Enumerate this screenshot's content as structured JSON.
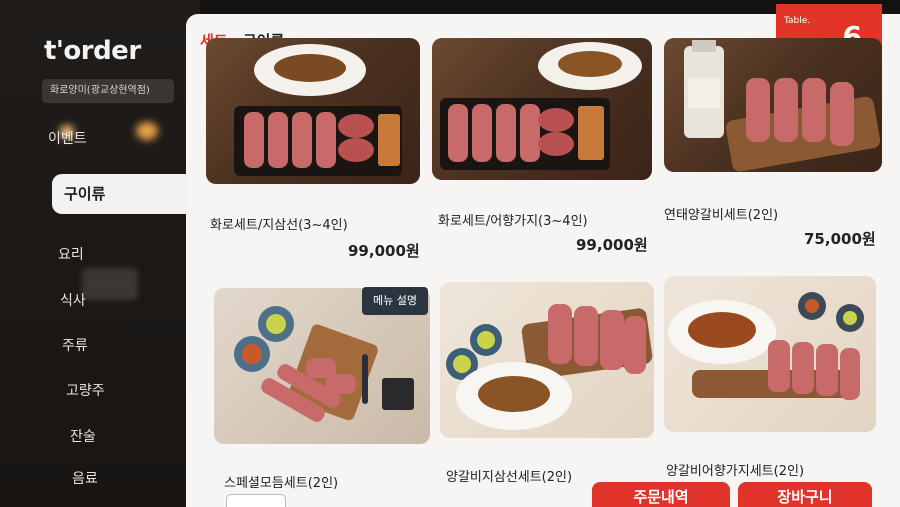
{
  "brand": {
    "logo": "t'order",
    "store": "화로양미(광교상현역점)"
  },
  "sidebar": {
    "items": [
      {
        "label": "이벤트"
      },
      {
        "label": "구이류",
        "active": true
      },
      {
        "label": "요리"
      },
      {
        "label": "식사"
      },
      {
        "label": "주류"
      },
      {
        "label": "고량주"
      },
      {
        "label": "잔술"
      },
      {
        "label": "음료"
      }
    ]
  },
  "header": {
    "category": "세트",
    "subcategory": "구이류"
  },
  "table": {
    "label": "Table.",
    "number": "6"
  },
  "menu": {
    "items": [
      {
        "name": "화로세트/지삼선(3~4인)",
        "price": "99,000원"
      },
      {
        "name": "화로세트/어향가지(3~4인)",
        "price": "99,000원"
      },
      {
        "name": "연태양갈비세트(2인)",
        "price": "75,000원"
      },
      {
        "name": "스페셜모듬세트(2인)",
        "badge": "메뉴 설명"
      },
      {
        "name": "양갈비지삼선세트(2인)"
      },
      {
        "name": "양갈비어향가지세트(2인)"
      }
    ]
  },
  "actions": {
    "order_history": "주문내역",
    "cart": "장바구니"
  },
  "colors": {
    "accent": "#e0342a",
    "sidebar": "#1f1c1a",
    "panel": "#f6f5f3"
  }
}
